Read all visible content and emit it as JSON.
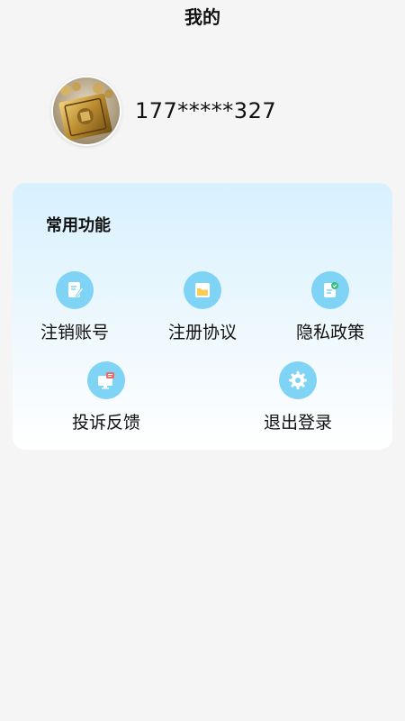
{
  "header": {
    "title": "我的"
  },
  "profile": {
    "phone": "177*****327"
  },
  "functions": {
    "title": "常用功能",
    "items": [
      {
        "label": "注销账号",
        "icon": "edit-document-icon"
      },
      {
        "label": "注册协议",
        "icon": "folder-icon"
      },
      {
        "label": "隐私政策",
        "icon": "verified-document-icon"
      },
      {
        "label": "投诉反馈",
        "icon": "feedback-monitor-icon"
      },
      {
        "label": "退出登录",
        "icon": "gear-icon"
      }
    ]
  },
  "colors": {
    "background": "#f5f5f5",
    "icon_circle": "#7fd3f4",
    "card_gradient_top": "#d7f1fe",
    "card_gradient_bottom": "#ffffff"
  }
}
